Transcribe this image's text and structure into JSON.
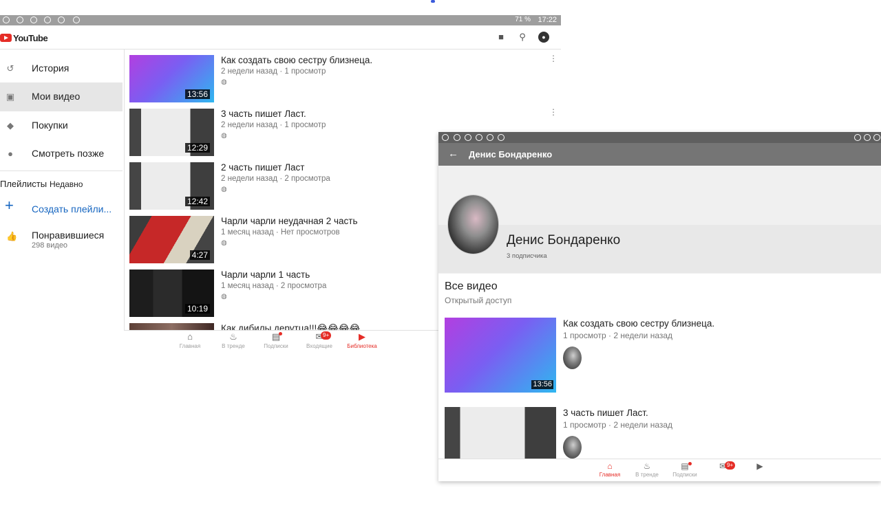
{
  "left": {
    "status": {
      "battery": "71 %",
      "time": "17:22"
    },
    "app": {
      "logo_text": "YouTube",
      "icons": [
        "camera-icon",
        "search-icon",
        "account-icon"
      ]
    },
    "sidebar": {
      "items": [
        {
          "label": "История",
          "icon": "history-icon"
        },
        {
          "label": "Мои видео",
          "icon": "my-videos-icon",
          "active": true
        },
        {
          "label": "Покупки",
          "icon": "tag-icon"
        },
        {
          "label": "Смотреть позже",
          "icon": "clock-icon"
        }
      ],
      "playlists_header": "Плейлисты",
      "playlists_sort": "Недавно",
      "create_playlist": "Создать плейли...",
      "liked": {
        "title": "Понравившиеся",
        "count": "298 видео"
      }
    },
    "videos": [
      {
        "title": "Как создать свою сестру близнеца.",
        "meta": "2 недели назад · 1 просмотр",
        "duration": "13:56",
        "thumb": "th-grad"
      },
      {
        "title": "3 часть пишет Ласт.",
        "meta": "2 недели назад · 1 просмотр",
        "duration": "12:29",
        "thumb": "th-screen"
      },
      {
        "title": "2 часть пишет Ласт",
        "meta": "2 недели назад · 2 просмотра",
        "duration": "12:42",
        "thumb": "th-screen"
      },
      {
        "title": "Чарли чарли неудачная 2 часть",
        "meta": "1 месяц назад · Нет просмотров",
        "duration": "4:27",
        "thumb": "th-red"
      },
      {
        "title": "Чарли чарли 1 часть",
        "meta": "1 месяц назад · 2 просмотра",
        "duration": "10:19",
        "thumb": "th-dark"
      },
      {
        "title": "Как дибилы дерутца!!!😂😂😂😂",
        "meta": "",
        "duration": "",
        "thumb": "th-brown"
      }
    ],
    "bottom_nav": [
      {
        "label": "Главная",
        "icon": "home-icon"
      },
      {
        "label": "В тренде",
        "icon": "fire-icon"
      },
      {
        "label": "Подписки",
        "icon": "subscriptions-icon",
        "dot": true
      },
      {
        "label": "Входящие",
        "icon": "inbox-icon",
        "badge": "9+"
      },
      {
        "label": "Библиотека",
        "icon": "library-icon",
        "active": true
      }
    ]
  },
  "right": {
    "title": "Денис Бондаренко",
    "channel": {
      "name": "Денис Бондаренко",
      "subscribers": "3 подписчика"
    },
    "section": {
      "title": "Все видео",
      "subtitle": "Открытый доступ"
    },
    "videos": [
      {
        "title": "Как создать свою сестру близнеца.",
        "meta": "1 просмотр · 2 недели назад",
        "duration": "13:56",
        "thumb": "th-grad"
      },
      {
        "title": "3 часть пишет Ласт.",
        "meta": "1 просмотр · 2 недели назад",
        "duration": "",
        "thumb": "th-screen"
      }
    ],
    "bottom_nav": [
      {
        "label": "Главная",
        "icon": "home-icon",
        "active": true
      },
      {
        "label": "В тренде",
        "icon": "fire-icon"
      },
      {
        "label": "Подписки",
        "icon": "subscriptions-icon",
        "dot": true
      },
      {
        "label": "",
        "icon": "inbox-icon",
        "badge": "9+"
      },
      {
        "label": "",
        "icon": "library-icon"
      }
    ]
  }
}
